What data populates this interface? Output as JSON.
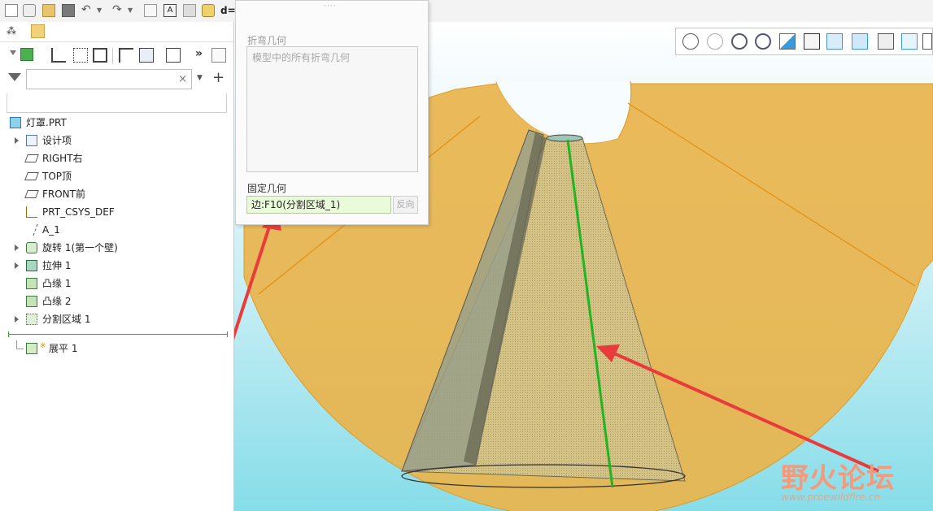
{
  "toolbar": {
    "d_label": "d="
  },
  "model_tree": {
    "root": "灯罩.PRT",
    "items": [
      {
        "label": "设计项",
        "icon": "design-items-icon",
        "expandable": true
      },
      {
        "label": "RIGHT右",
        "icon": "datum-plane-icon",
        "expandable": false
      },
      {
        "label": "TOP顶",
        "icon": "datum-plane-icon",
        "expandable": false
      },
      {
        "label": "FRONT前",
        "icon": "datum-plane-icon",
        "expandable": false
      },
      {
        "label": "PRT_CSYS_DEF",
        "icon": "csys-icon",
        "expandable": false
      },
      {
        "label": "A_1",
        "icon": "axis-icon",
        "expandable": false
      },
      {
        "label": "旋转 1(第一个壁)",
        "icon": "revolve-icon",
        "expandable": true
      },
      {
        "label": "拉伸 1",
        "icon": "extrude-icon",
        "expandable": true
      },
      {
        "label": "凸缘 1",
        "icon": "flange-icon",
        "expandable": false
      },
      {
        "label": "凸缘 2",
        "icon": "flange-icon",
        "expandable": false
      },
      {
        "label": "分割区域 1",
        "icon": "split-area-icon",
        "expandable": true
      }
    ],
    "insert_item": {
      "prefix": "※",
      "label": "展平 1",
      "icon": "unbend-icon"
    }
  },
  "search": {
    "placeholder": "",
    "clear_symbol": "×",
    "dropdown_symbol": "▼",
    "add_symbol": "+"
  },
  "panel": {
    "bend_geom_label": "折弯几何",
    "bend_geom_value": "模型中的所有折弯几何",
    "fixed_geom_label": "固定几何",
    "fixed_geom_value": "边:F10(分割区域_1)",
    "flip_label": "反向"
  },
  "watermark": {
    "cn": "野火论坛",
    "url": "www.proewildfire.cn"
  },
  "colors": {
    "accent_green": "#22b422",
    "arrow_red": "#ea3b3b",
    "sheet_orange": "#e9b44c",
    "cone": "#cfc08a"
  }
}
